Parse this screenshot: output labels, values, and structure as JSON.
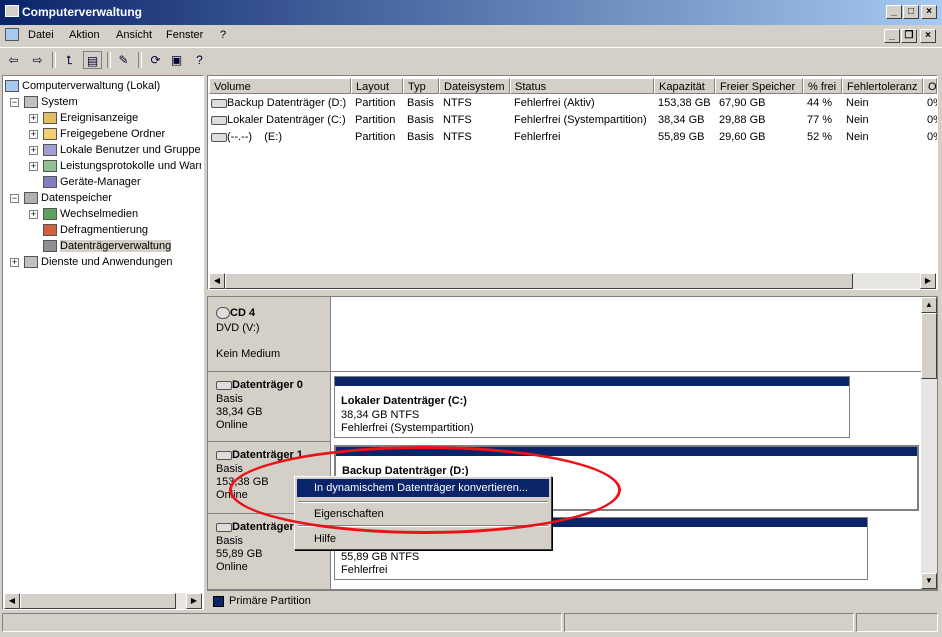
{
  "window": {
    "title": "Computerverwaltung"
  },
  "menu": [
    "Datei",
    "Aktion",
    "Ansicht",
    "Fenster",
    "?"
  ],
  "tree": {
    "root": "Computerverwaltung (Lokal)",
    "system": "System",
    "system_items": [
      "Ereignisanzeige",
      "Freigegebene Ordner",
      "Lokale Benutzer und Gruppen",
      "Leistungsprotokolle und Warnungen",
      "Geräte-Manager"
    ],
    "storage": "Datenspeicher",
    "storage_items": [
      "Wechselmedien",
      "Defragmentierung",
      "Datenträgerverwaltung"
    ],
    "services": "Dienste und Anwendungen"
  },
  "volumes": {
    "columns": [
      "Volume",
      "Layout",
      "Typ",
      "Dateisystem",
      "Status",
      "Kapazität",
      "Freier Speicher",
      "% frei",
      "Fehlertoleranz",
      "Overhead"
    ],
    "rows": [
      [
        "Backup Datenträger (D:)",
        "Partition",
        "Basis",
        "NTFS",
        "Fehlerfrei (Aktiv)",
        "153,38 GB",
        "67,90 GB",
        "44 %",
        "Nein",
        "0%"
      ],
      [
        "Lokaler Datenträger (C:)",
        "Partition",
        "Basis",
        "NTFS",
        "Fehlerfrei (Systempartition)",
        "38,34 GB",
        "29,88 GB",
        "77 %",
        "Nein",
        "0%"
      ],
      [
        "(--.--)    (E:)",
        "Partition",
        "Basis",
        "NTFS",
        "Fehlerfrei",
        "55,89 GB",
        "29,60 GB",
        "52 %",
        "Nein",
        "0%"
      ]
    ]
  },
  "disks": [
    {
      "name": "CD 4",
      "type": "DVD (V:)",
      "size": "",
      "status": "Kein Medium"
    },
    {
      "name": "Datenträger 0",
      "type": "Basis",
      "size": "38,34 GB",
      "status": "Online",
      "partition": {
        "title": "Lokaler Datenträger  (C:)",
        "size": "38,34 GB NTFS",
        "status": "Fehlerfrei (Systempartition)"
      }
    },
    {
      "name": "Datenträger 1",
      "type": "Basis",
      "size": "153,38 GB",
      "status": "Online",
      "partition": {
        "title": "Backup Datenträger  (D:)",
        "size": "",
        "status": ""
      }
    },
    {
      "name": "Datenträger 2",
      "type": "Basis",
      "size": "55,89 GB",
      "status": "Online",
      "partition": {
        "title": "",
        "size": "55,89 GB NTFS",
        "status": "Fehlerfrei"
      }
    }
  ],
  "legend": {
    "label": "Primäre Partition",
    "color": "#0a246a"
  },
  "context_menu": [
    "In dynamischem Datenträger konvertieren...",
    "Eigenschaften",
    "Hilfe"
  ],
  "colors": {
    "titlebar_start": "#0a246a",
    "titlebar_end": "#a6caf0",
    "selection": "#0a246a",
    "highlight_oval": "#e8141a"
  },
  "icons": [
    "computer-icon",
    "back-icon",
    "forward-icon",
    "up-folder-icon",
    "show-tree-icon",
    "properties-icon",
    "refresh-icon",
    "help-icon",
    "disk-icon",
    "cd-icon"
  ]
}
